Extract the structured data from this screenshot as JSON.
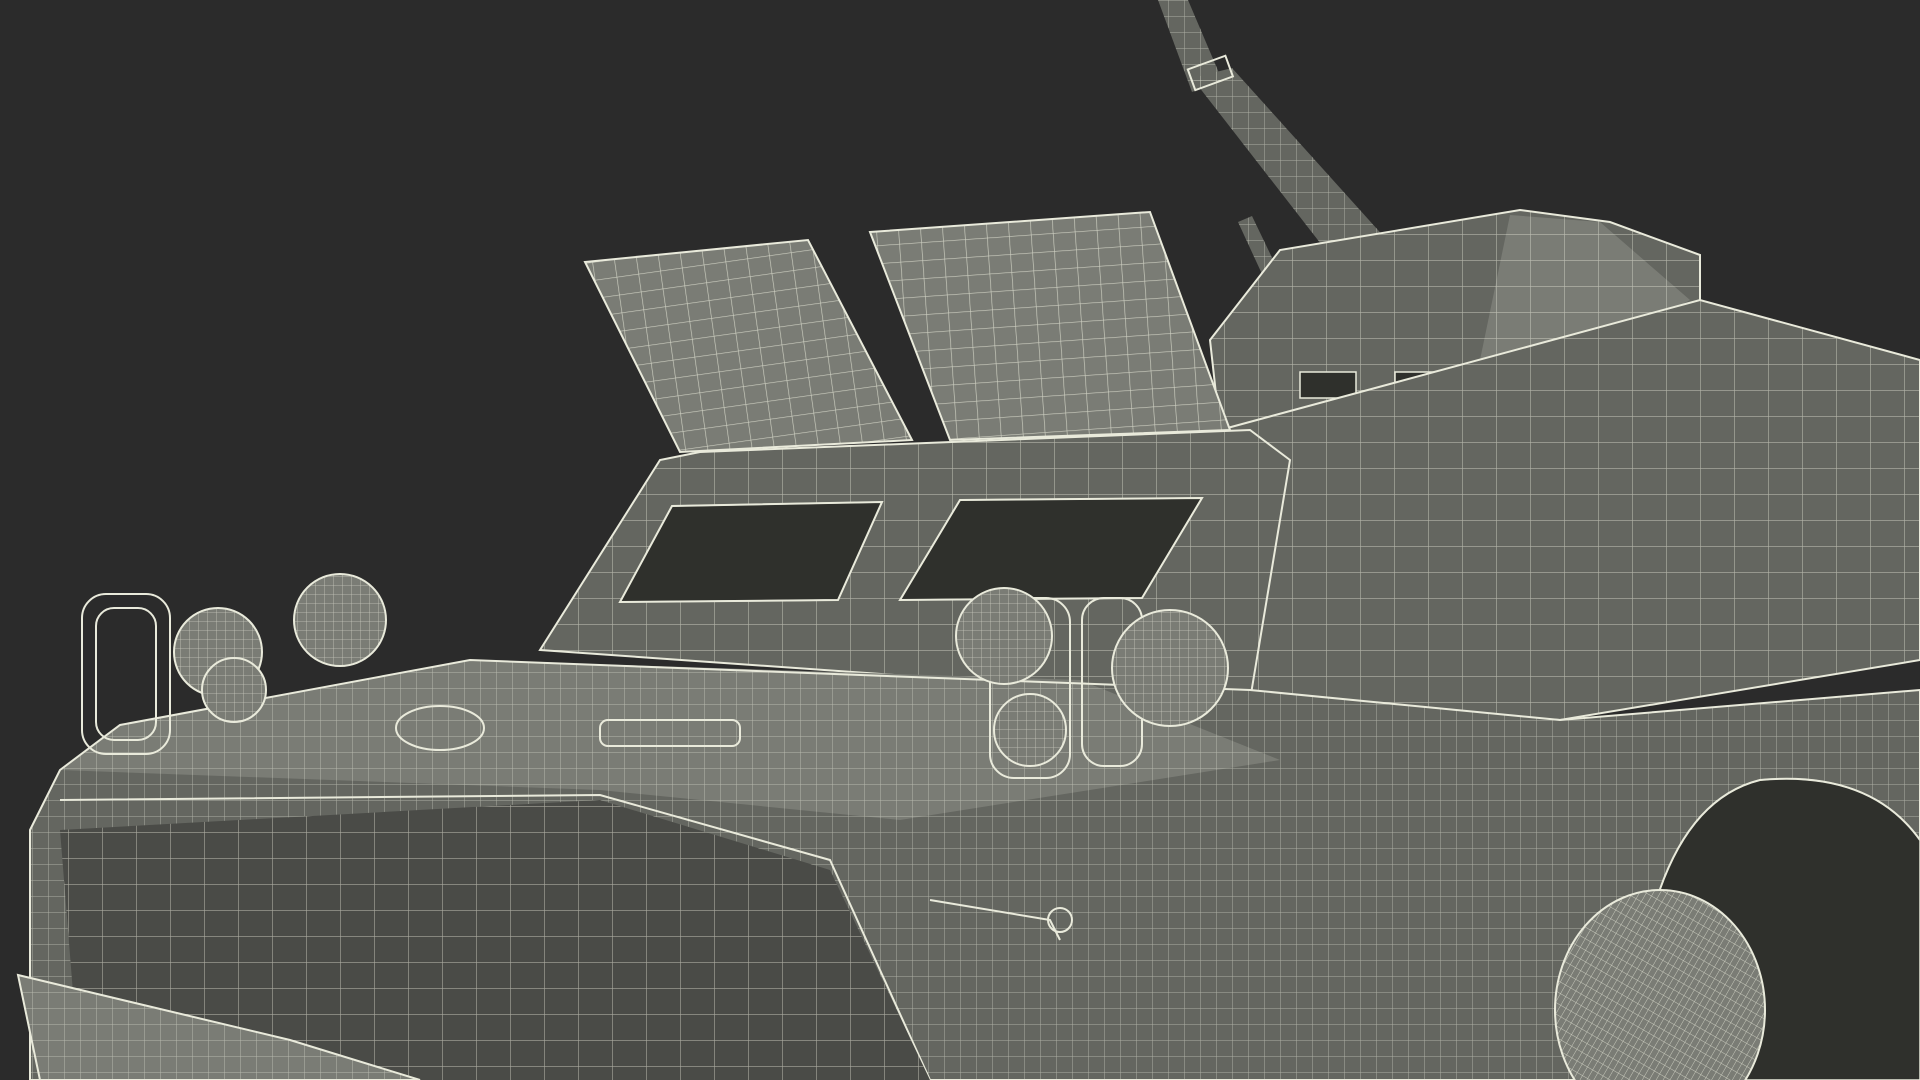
{
  "render": {
    "background_color": "#2b2b2b",
    "surface_color": "#646660",
    "surface_light": "#7a7c75",
    "surface_dark": "#4a4b47",
    "wire_color": "#e9eadb",
    "glass_color": "#2f302c"
  },
  "scene": {
    "subject": "armored-reconnaissance-vehicle-wireframe",
    "parts": [
      "cannon",
      "open-hatch-left",
      "open-hatch-right",
      "turret",
      "hull-front",
      "windshield-left",
      "windshield-right",
      "headlight-cluster-left",
      "headlight-cluster-right",
      "wheel-arch",
      "front-wheel",
      "bumper-plate"
    ]
  }
}
